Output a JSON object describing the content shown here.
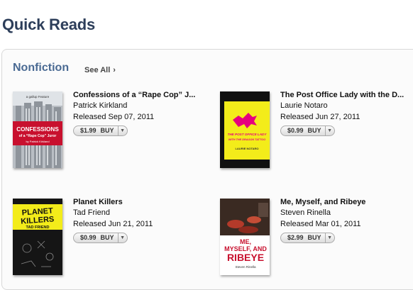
{
  "page": {
    "title": "Quick Reads"
  },
  "section": {
    "title": "Nonfiction",
    "see_all": "See All",
    "see_all_icon": "chevron-right-icon"
  },
  "books": [
    {
      "title": "Confessions of a “Rape Cop” J...",
      "author": "Patrick Kirkland",
      "released": "Released Sep 07, 2011",
      "price": "$1.99",
      "buy": "BUY",
      "cover": {
        "top_text": "a gallup Feature",
        "title1": "CONFESSIONS",
        "title2": "of a “Rape Cop” Juror",
        "byline": "by Patrick Kirkland"
      }
    },
    {
      "title": "The Post Office Lady with the D...",
      "author": "Laurie Notaro",
      "released": "Released Jun 27, 2011",
      "price": "$0.99",
      "buy": "BUY",
      "cover": {
        "title1": "THE POST OFFICE LADY",
        "title2": "WITH THE DRAGON TATTOO",
        "byline": "LAURIE NOTARO"
      }
    },
    {
      "title": "Planet Killers",
      "author": "Tad Friend",
      "released": "Released Jun 21, 2011",
      "price": "$0.99",
      "buy": "BUY",
      "cover": {
        "title1": "PLANET",
        "title2": "KILLERS",
        "byline": "TAD FRIEND"
      }
    },
    {
      "title": "Me, Myself, and Ribeye",
      "author": "Steven Rinella",
      "released": "Released Mar 01, 2011",
      "price": "$2.99",
      "buy": "BUY",
      "cover": {
        "title1": "ME,",
        "title2": "MYSELF, AND",
        "title3": "RIBEYE",
        "byline": "Steven Rinella"
      }
    }
  ],
  "colors": {
    "title": "#2d3e5a",
    "section": "#4a6a93",
    "cover_red": "#c8102e",
    "cover_yellow": "#f3ec1a",
    "cover_magenta": "#e6007e"
  }
}
